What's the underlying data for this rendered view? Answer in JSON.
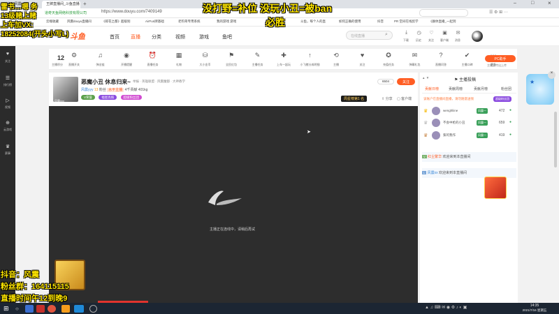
{
  "overlay_texts": {
    "top_left_lines": [
      "雷书…嗯 务",
      "13级赌上赌",
      "上车加VX:",
      "18252084(开头小写L)"
    ],
    "top_center_line1": "没打野=补位 没玩小丑=被ban",
    "top_center_line2": "必胜",
    "bottom_left_lines": [
      "抖音：风震",
      "粉丝群：164115115",
      "直播时间午12到晚9"
    ]
  },
  "browser": {
    "tabs": [
      "斗鱼 - 风震",
      "王牌直播间_斗鱼直播"
    ],
    "new_tab": "+",
    "url": "https://www.douyu.com/7409149",
    "site_id": "道奇天鱼网络科技有限公司",
    "bookmarks": [
      "云端收藏",
      "风震douyu直播间",
      "《碎花之都》超级别",
      "AirFun牌基础",
      "老钓哥专用系统",
      "我的游戏 游戏",
      "斗鱼，每个人的直",
      "如何正确的使用",
      "抖音",
      "PR 空间在线剪学",
      "《群体直播_一起到"
    ]
  },
  "site_header": {
    "logo": "斗鱼",
    "nav": [
      "首页",
      "直播",
      "分类",
      "视频",
      "游戏",
      "鱼吧"
    ],
    "search_placeholder": "在线直播",
    "header_icons": [
      "下载",
      "历史",
      "关注",
      "客户端",
      "消息"
    ]
  },
  "toolbar": {
    "level_num": "12",
    "level_label": "主播积分",
    "items": [
      "直播开关",
      "弹出链",
      "开播提醒",
      "直播任务",
      "礼物",
      "大小金币",
      "全民红包",
      "主播任务",
      "上车一起玩",
      "小飞猪分成明细",
      "主播",
      "关注",
      "充值任务",
      "弹幕礼包",
      "直播问答",
      "主播口碑",
      "更多"
    ],
    "right_btn": "PC助手",
    "right_sub": "主播宣传出上传"
  },
  "room": {
    "title": "恶魔小丑 休息归来~",
    "meta_tags": [
      "举报",
      "英雄联盟",
      "风震魔都",
      "大神教学"
    ],
    "streamer": "风震yyy",
    "level": "13",
    "follow_label": "粉丝",
    "tag2": "水平主播",
    "followers": "4千贡献",
    "weight": "401kg",
    "badges": [
      "V荣誉",
      "福星高照",
      "超级粉丝团"
    ],
    "score": "6504",
    "follow_btn": "关注",
    "rank_btn": "周星榜第1 名",
    "share": "分享",
    "report": "客户端"
  },
  "player": {
    "status": "主播正在连线中，请稍后再试"
  },
  "right_panel": {
    "tabs": [
      "贡献日榜",
      "贡献周榜",
      "贡献月榜",
      "粉丝团"
    ],
    "header_title": "主播投稿",
    "notice": "该账户在直播间直播，请勿随意送钱",
    "notice_btn": "超级粉丝团",
    "ranks": [
      {
        "name": "wenghliine",
        "badge": "风震一",
        "value": "472"
      },
      {
        "name": "不会中枪的小丑",
        "badge": "风震一",
        "value": "659"
      },
      {
        "name": "紫的我作",
        "badge": "风震一",
        "value": "419"
      }
    ],
    "messages": [
      {
        "name": "红尘繁华",
        "text": "欢迎来到本直播间"
      },
      {
        "name": "风震xx",
        "text": "欢迎来到本直播间"
      }
    ]
  },
  "taskbar": {
    "time": "14:35",
    "date": "2021/7/16 星期五"
  },
  "colors": {
    "accent": "#ff5d23",
    "overlay": "#ffe600",
    "player_bg": "#2d2d2d",
    "sidebar_bg": "#2b2b2b",
    "taskbar_bg": "#1c2633"
  }
}
